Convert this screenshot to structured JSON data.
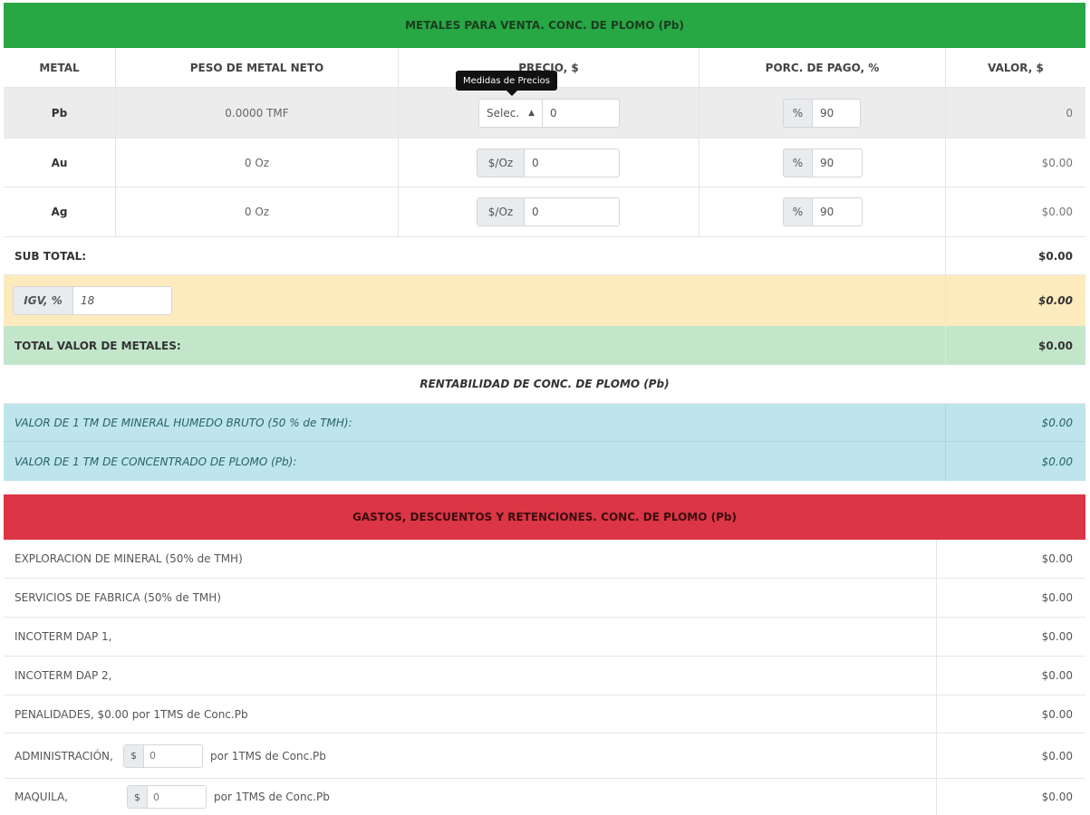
{
  "section1": {
    "title": "METALES PARA VENTA. CONC. DE PLOMO (Pb)",
    "headers": [
      "METAL",
      "PESO DE METAL NETO",
      "PRECIO, $",
      "PORC. DE PAGO, %",
      "VALOR, $"
    ],
    "tooltip": "Medidas de Precios",
    "rows": [
      {
        "metal": "Pb",
        "peso": "0.0000 TMF",
        "price_select": "Selec.",
        "price_value": "0",
        "pct_addon": "%",
        "pct_value": "90",
        "valor": "0"
      },
      {
        "metal": "Au",
        "peso": "0 Oz",
        "price_addon": "$/Oz",
        "price_value": "0",
        "pct_addon": "%",
        "pct_value": "90",
        "valor": "$0.00"
      },
      {
        "metal": "Ag",
        "peso": "0 Oz",
        "price_addon": "$/Oz",
        "price_value": "0",
        "pct_addon": "%",
        "pct_value": "90",
        "valor": "$0.00"
      }
    ],
    "subtotal_label": "SUB TOTAL:",
    "subtotal_value": "$0.00",
    "igv_addon": "IGV, %",
    "igv_value": "18",
    "igv_amount": "$0.00",
    "total_label": "TOTAL VALOR DE METALES:",
    "total_value": "$0.00"
  },
  "rentabilidad": {
    "title": "RENTABILIDAD DE CONC. DE PLOMO (Pb)",
    "rows": [
      {
        "label": "VALOR DE 1 TM DE MINERAL HUMEDO BRUTO (50 % de TMH):",
        "value": "$0.00"
      },
      {
        "label": "VALOR DE 1 TM DE CONCENTRADO DE PLOMO (Pb):",
        "value": "$0.00"
      }
    ]
  },
  "section2": {
    "title": "GASTOS, DESCUENTOS Y RETENCIONES. CONC. DE PLOMO (Pb)",
    "rows": [
      {
        "label": "EXPLORACION DE MINERAL (50% de TMH)",
        "value": "$0.00"
      },
      {
        "label": "SERVICIOS DE FABRICA (50% de TMH)",
        "value": "$0.00"
      },
      {
        "label": "INCOTERM DAP 1,",
        "value": "$0.00"
      },
      {
        "label": "INCOTERM DAP 2,",
        "value": "$0.00"
      },
      {
        "label": "PENALIDADES, $0.00 por 1TMS de Conc.Pb",
        "value": "$0.00"
      }
    ],
    "admin": {
      "label": "ADMINISTRACIÓN,",
      "addon": "$",
      "value": "0",
      "suffix": "por 1TMS de Conc.Pb",
      "amount": "$0.00"
    },
    "maquila": {
      "label": "MAQUILA,",
      "addon": "$",
      "value": "0",
      "suffix": "por 1TMS de Conc.Pb",
      "amount": "$0.00"
    }
  }
}
